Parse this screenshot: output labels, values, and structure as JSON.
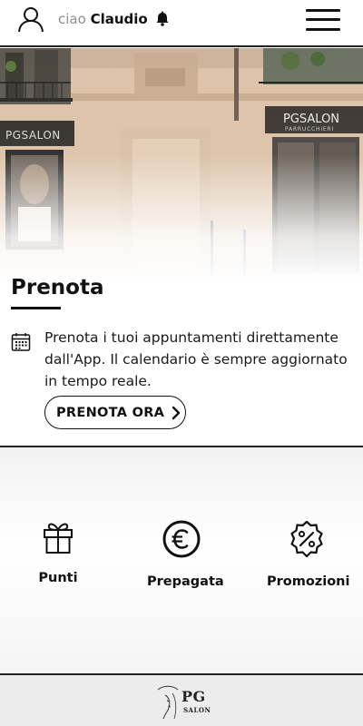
{
  "header": {
    "greeting_prefix": "ciao",
    "user_name": "Claudio",
    "user_icon": "user-icon",
    "notification_icon": "bell-icon",
    "menu_icon": "hamburger-menu-icon"
  },
  "hero": {
    "image": "salon-storefront-photo",
    "signage": [
      "PGSALON",
      "PARRUCCHIERI"
    ]
  },
  "prenota": {
    "title": "Prenota",
    "description": "Prenota i tuoi appuntamenti direttamente dall'App. Il calendario è sempre aggiornato in tempo reale.",
    "icon": "calendar-icon",
    "cta_label": "PRENOTA ORA"
  },
  "features": [
    {
      "label": "Punti",
      "icon": "gift-icon"
    },
    {
      "label": "Prepagata",
      "icon": "euro-icon"
    },
    {
      "label": "Promozioni",
      "icon": "percent-badge-icon"
    }
  ],
  "footer": {
    "logo_text": "PG",
    "logo_subtext": "SALON"
  },
  "colors": {
    "text": "#111111",
    "greeting_muted": "#8e8e8e",
    "divider": "#222222",
    "footer_bg": "#ececec"
  }
}
